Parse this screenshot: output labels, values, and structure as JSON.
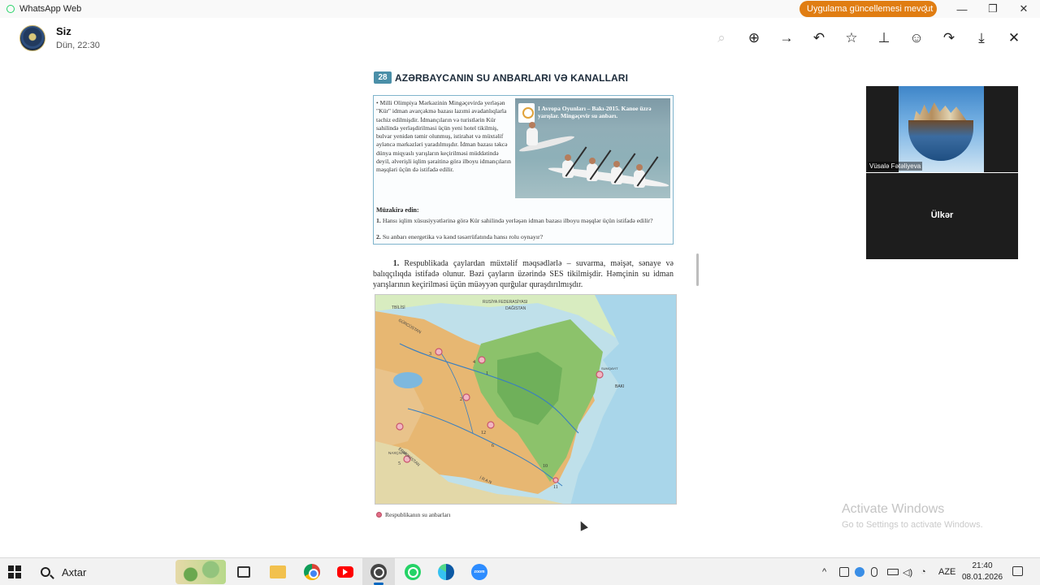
{
  "window": {
    "app_title": "WhatsApp Web",
    "update_label": "Uygulama güncellemesi mevcut",
    "update_more_glyph": "⋮",
    "minimize_glyph": "—",
    "restore_glyph": "❐",
    "close_glyph": "✕"
  },
  "viewer": {
    "sender": "Siz",
    "time": "Dün, 22:30",
    "icons": [
      "zoom-out-icon",
      "zoom-in-icon",
      "forward-arrow-icon",
      "reply-icon",
      "star-icon",
      "pin-icon",
      "emoji-icon",
      "share-icon",
      "download-icon",
      "close-icon"
    ],
    "glyphs": {
      "zoom_out": "⌕",
      "zoom_in": "⊕",
      "arrow": "→",
      "reply": "↶",
      "star": "☆",
      "pin": "⊥",
      "emoji": "☺",
      "share": "↷",
      "download": "⤓",
      "close": "✕"
    }
  },
  "document": {
    "lesson_number": "28",
    "lesson_title": "Azərbaycanın su anbarları və kanalları",
    "box_text": "• Milli Olimpiya Mərkəzinin Mingəçevirdə yerləşən \"Kür\" idman avarçəkmə bazası lazımi avadanlıqlarla təchiz edilmişdir. İdmançıların və turistlərin Kür sahilində yerləşdirilməsi üçün yeni hotel tikilmiş, bulvar yenidən təmir olunmuş, istirahət və müxtəlif əyləncə mərkəzləri yaradılmışdır. İdman bazası təkcə dünya miqyaslı yarışların keçirilməsi müddətində deyil, əlverişli iqlim şəraitinə görə ilboyu idmançıların məşqləri üçün də istifadə edilir.",
    "photo_caption": "I Avropa Oyunları – Bakı-2015. Kanoe üzrə yarışlar. Mingəçevir su anbarı.",
    "discuss_heading": "Müzakirə edin:",
    "q1_num": "1.",
    "q1": "Hansı iqlim xüsusiyyətlərinə görə Kür sahilində yerləşən idman bazası ilboyu məşqlər üçün istifadə edilir?",
    "q2_num": "2.",
    "q2": "Su anbarı energetika və kənd təsərrüfatında hansı rolu oynayır?",
    "para_num": "1.",
    "paragraph": "Respublikada çaylardan müxtəlif məqsədlərlə – suvarma, məişət, sənaye və balıqçılıqda istifadə olunur. Bəzi çayların üzərində SES tikilmişdir. Həmçinin su idman yarışlarının keçirilməsi üçün müəyyən qurğular quraşdırılmışdır.",
    "legend": "Respublikanın su anbarları",
    "map_labels": {
      "tbilisi": "TBİLİSİ",
      "georgia": "GÜRCÜSTAN",
      "russia": "RUSİYA FEDERASİYASI",
      "dagestan": "DAĞISTAN",
      "armenia": "ERMƏNİSTAN",
      "nakhchivan": "NAXÇIVAN",
      "iran": "İ R A N",
      "baku": "BAKI",
      "sumgait": "SUMQAYIT",
      "n1": "1",
      "n2": "2",
      "n3": "3",
      "n4": "4",
      "n5": "5",
      "n6": "6",
      "n10": "10",
      "n11": "11",
      "n12": "12"
    }
  },
  "tiles": {
    "tile1_name": "Vüsalə Fətəliyeva",
    "tile2_name": "Ülkər"
  },
  "watermark": {
    "line1": "Activate Windows",
    "line2": "Go to Settings to activate Windows."
  },
  "taskbar": {
    "search_label": "Axtar",
    "zoom_label": "zoom",
    "lang": "AZE",
    "time": "21:40",
    "date": "08.01.2026",
    "tray_up": "^",
    "tray_net": "◔",
    "tray_vol": "◁)"
  }
}
